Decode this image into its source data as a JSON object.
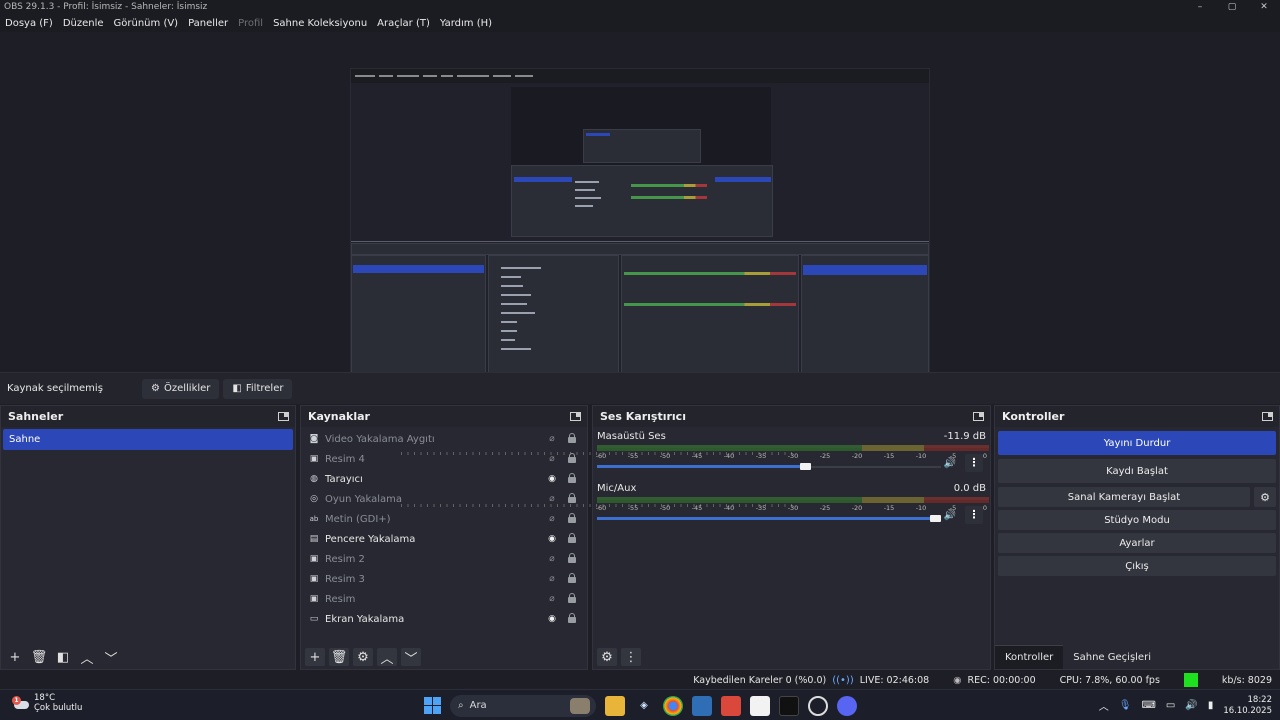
{
  "window": {
    "title": "OBS 29.1.3 - Profil: İsimsiz - Sahneler: İsimsiz",
    "controls": [
      "–",
      "▢",
      "✕"
    ]
  },
  "menu": {
    "items": [
      {
        "label": "Dosya (F)",
        "disabled": false
      },
      {
        "label": "Düzenle",
        "disabled": false
      },
      {
        "label": "Görünüm (V)",
        "disabled": false
      },
      {
        "label": "Paneller",
        "disabled": false
      },
      {
        "label": "Profil",
        "disabled": true
      },
      {
        "label": "Sahne Koleksiyonu",
        "disabled": false
      },
      {
        "label": "Araçlar (T)",
        "disabled": false
      },
      {
        "label": "Yardım (H)",
        "disabled": false
      }
    ]
  },
  "source_toolbar": {
    "no_selection": "Kaynak seçilmemiş",
    "properties_label": "Özellikler",
    "filters_label": "Filtreler"
  },
  "scenes": {
    "title": "Sahneler",
    "items": [
      {
        "label": "Sahne",
        "selected": true
      }
    ]
  },
  "sources": {
    "title": "Kaynaklar",
    "items": [
      {
        "label": "Video Yakalama Aygıtı",
        "icon": "camera-icon",
        "visible": false
      },
      {
        "label": "Resim 4",
        "icon": "image-icon",
        "visible": false
      },
      {
        "label": "Tarayıcı",
        "icon": "globe-icon",
        "visible": true
      },
      {
        "label": "Oyun Yakalama",
        "icon": "gamepad-icon",
        "visible": false
      },
      {
        "label": "Metin (GDI+)",
        "icon": "text-icon",
        "visible": false
      },
      {
        "label": "Pencere Yakalama",
        "icon": "window-icon",
        "visible": true
      },
      {
        "label": "Resim 2",
        "icon": "image-icon",
        "visible": false
      },
      {
        "label": "Resim 3",
        "icon": "image-icon",
        "visible": false
      },
      {
        "label": "Resim",
        "icon": "image-icon",
        "visible": false
      },
      {
        "label": "Ekran Yakalama",
        "icon": "monitor-icon",
        "visible": true
      }
    ]
  },
  "mixer": {
    "title": "Ses Karıştırıcı",
    "ticks": [
      "-60",
      "-55",
      "-50",
      "-45",
      "-40",
      "-35",
      "-30",
      "-25",
      "-20",
      "-15",
      "-10",
      "-5",
      "0"
    ],
    "channels": [
      {
        "name": "Masaüstü Ses",
        "level": "-11.9 dB",
        "volume_fraction": 0.61
      },
      {
        "name": "Mic/Aux",
        "level": "0.0 dB",
        "volume_fraction": 1.0
      }
    ]
  },
  "controls": {
    "title": "Kontroller",
    "stop_stream": "Yayını Durdur",
    "start_recording": "Kaydı Başlat",
    "virtual_camera": "Sanal Kamerayı Başlat",
    "studio_mode": "Stüdyo Modu",
    "settings": "Ayarlar",
    "exit": "Çıkış",
    "tabs": [
      "Kontroller",
      "Sahne Geçişleri"
    ]
  },
  "status": {
    "dropped_frames": "Kaybedilen Kareler 0 (%0.0)",
    "live": "LIVE: 02:46:08",
    "rec": "REC: 00:00:00",
    "cpu": "CPU: 7.8%, 60.00 fps",
    "bitrate": "kb/s: 8029",
    "colors": {
      "health": "#1ee01e",
      "accent": "#2c47b8"
    }
  },
  "taskbar": {
    "temperature": "18°C",
    "weather": "Çok bulutlu",
    "weather_badge": "1",
    "search_placeholder": "Ara",
    "time": "18:22",
    "date": "16.10.2025"
  }
}
